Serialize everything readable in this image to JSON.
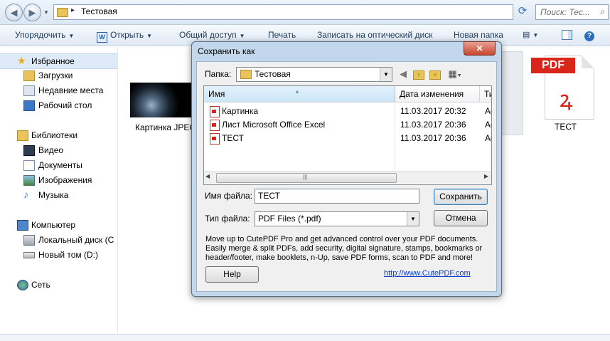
{
  "explorer": {
    "address": {
      "separator": "▸",
      "folder": "Тестовая"
    },
    "search": {
      "placeholder": "Поиск: Тес..."
    },
    "toolbar": {
      "organize": "Упорядочить",
      "open": "Открыть",
      "share": "Общий доступ",
      "print": "Печать",
      "burn": "Записать на оптический диск",
      "new_folder": "Новая папка"
    },
    "sidebar": {
      "favorites": "Избранное",
      "downloads": "Загрузки",
      "recent": "Недавние места",
      "desktop": "Рабочий стол",
      "libraries": "Библиотеки",
      "video": "Видео",
      "documents": "Документы",
      "pictures": "Изображения",
      "music": "Музыка",
      "computer": "Компьютер",
      "local_disk": "Локальный диск (C",
      "new_volume": "Новый том (D:)",
      "network": "Сеть"
    },
    "files": {
      "thumb_label": "Картинка JPEG",
      "pdf_banner": "PDF",
      "pdf_label": "ТЕСТ"
    }
  },
  "dialog": {
    "title": "Сохранить как",
    "close": "✕",
    "folder_label": "Папка:",
    "folder_value": "Тестовая",
    "columns": {
      "name": "Имя",
      "date": "Дата изменения",
      "type": "Ти"
    },
    "files": [
      {
        "name": "Картинка",
        "date": "11.03.2017 20:32",
        "type": "Ad"
      },
      {
        "name": "Лист Microsoft Office Excel",
        "date": "11.03.2017 20:36",
        "type": "Ad"
      },
      {
        "name": "ТЕСТ",
        "date": "11.03.2017 20:36",
        "type": "Ad"
      }
    ],
    "filename_label": "Имя файла:",
    "filename_value": "ТЕСТ",
    "filetype_label": "Тип файла:",
    "filetype_value": "PDF Files (*.pdf)",
    "save": "Сохранить",
    "cancel": "Отмена",
    "promo": "Move up to CutePDF Pro and get advanced control over your PDF documents. Easily merge & split PDFs, add security, digital signature, stamps, bookmarks or header/footer, make booklets, n-Up, save PDF forms, scan to PDF and more!",
    "help": "Help",
    "link": "http://www.CutePDF.com"
  }
}
